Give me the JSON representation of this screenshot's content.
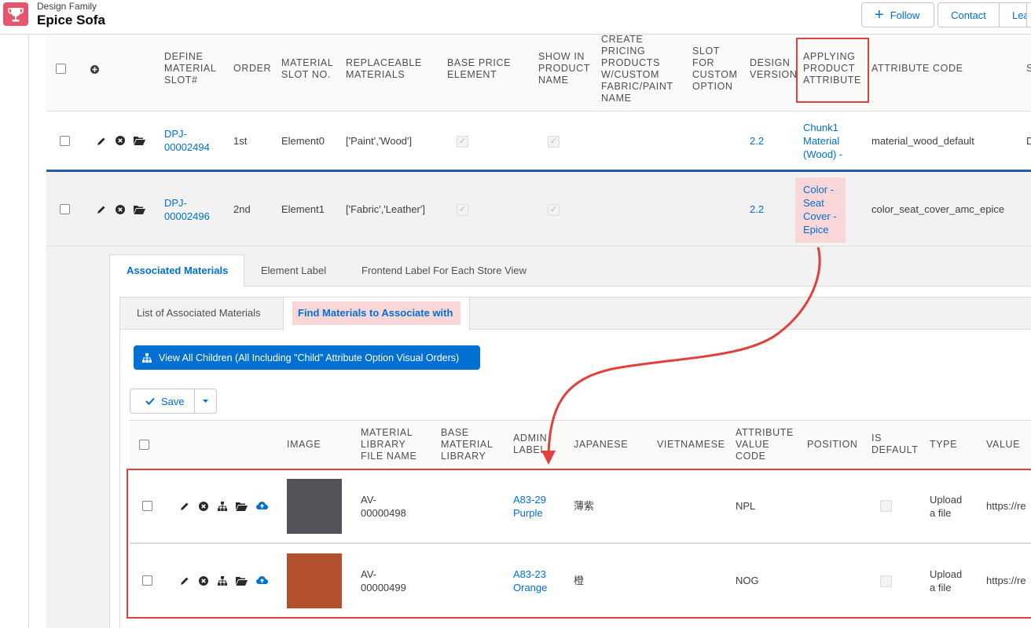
{
  "app": {
    "subtitle": "Design Family",
    "title": "Epice Sofa",
    "buttons": {
      "follow": "Follow",
      "contact": "Contact",
      "lead": "Lead"
    }
  },
  "slot_table": {
    "headers": {
      "define_slot": [
        "DEFINE",
        "MATERIAL",
        "SLOT#"
      ],
      "order": "ORDER",
      "slot_no": [
        "MATERIAL",
        "SLOT NO."
      ],
      "replaceable": [
        "REPLACEABLE",
        "MATERIALS"
      ],
      "base_price": [
        "BASE PRICE",
        "ELEMENT"
      ],
      "show_name": [
        "SHOW IN",
        "PRODUCT",
        "NAME"
      ],
      "create_pricing": [
        "CREATE",
        "PRICING",
        "PRODUCTS",
        "W/CUSTOM",
        "FABRIC/PAINT",
        "NAME"
      ],
      "slot_custom": [
        "SLOT",
        "FOR",
        "CUSTOM",
        "OPTION"
      ],
      "design_version": [
        "DESIGN",
        "VERSION"
      ],
      "applying_attr": [
        "APPLYING",
        "PRODUCT",
        "ATTRIBUTE"
      ],
      "attr_code": "ATTRIBUTE CODE",
      "s": "S"
    },
    "rows": [
      {
        "id": [
          "DPJ-",
          "00002494"
        ],
        "order": "1st",
        "slot_no": "Element0",
        "replaceable": "['Paint','Wood']",
        "version": "2.2",
        "attr": [
          "Chunk1",
          "Material",
          "(Wood) -"
        ],
        "attr_code": "material_wood_default",
        "trail": "D"
      },
      {
        "id": [
          "DPJ-",
          "00002496"
        ],
        "order": "2nd",
        "slot_no": "Element1",
        "replaceable": "['Fabric','Leather']",
        "version": "2.2",
        "attr": [
          "Color -",
          "Seat",
          "Cover -",
          "Epice"
        ],
        "attr_code": "color_seat_cover_amc_epice",
        "trail": ""
      }
    ]
  },
  "tabs": [
    "Associated Materials",
    "Element Label",
    "Frontend Label For Each Store View"
  ],
  "subtabs": [
    "List of Associated Materials",
    "Find Materials to Associate with"
  ],
  "view_children_button": "View All Children (All Including \"Child\" Attribute Option Visual Orders)",
  "save_button": "Save",
  "materials_table": {
    "headers": {
      "image": "IMAGE",
      "file_name": [
        "MATERIAL",
        "LIBRARY",
        "FILE NAME"
      ],
      "base_lib": [
        "BASE",
        "MATERIAL",
        "LIBRARY"
      ],
      "admin_label": [
        "ADMIN",
        "LABEL"
      ],
      "japanese": "JAPANESE",
      "vietnamese": "VIETNAMESE",
      "attr_value_code": [
        "ATTRIBUTE",
        "VALUE",
        "CODE"
      ],
      "position": "POSITION",
      "is_default": [
        "IS",
        "DEFAULT"
      ],
      "type": "TYPE",
      "value": "VALUE"
    },
    "rows": [
      {
        "swatch": "#54535a",
        "file": [
          "AV-",
          "00000498"
        ],
        "label": [
          "A83-29",
          "Purple"
        ],
        "japanese": "薄紫",
        "code": "NPL",
        "type": [
          "Upload",
          "a file"
        ],
        "value": "https://re"
      },
      {
        "swatch": "#b4502d",
        "file": [
          "AV-",
          "00000499"
        ],
        "label": [
          "A83-23",
          "Orange"
        ],
        "japanese": "橙",
        "code": "NOG",
        "type": [
          "Upload",
          "a file"
        ],
        "value": "https://re"
      }
    ]
  },
  "colors": {
    "accent": "#0070d2",
    "annotation_red": "#e0413d",
    "highlight_pink": "#f9d6d8",
    "app_icon": "#e3566d"
  }
}
